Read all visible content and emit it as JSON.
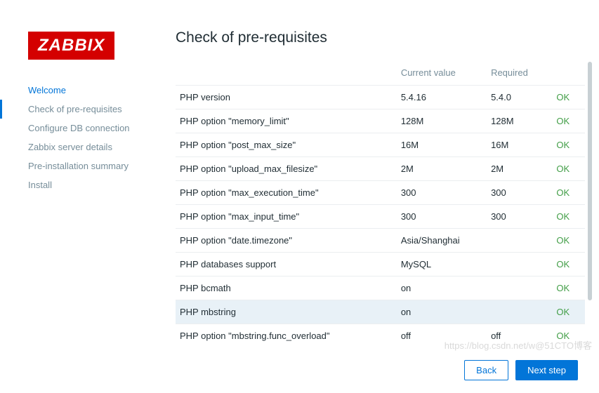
{
  "logo": "ZABBIX",
  "nav": [
    {
      "label": "Welcome",
      "state": "completed"
    },
    {
      "label": "Check of pre-requisites",
      "state": "active"
    },
    {
      "label": "Configure DB connection",
      "state": ""
    },
    {
      "label": "Zabbix server details",
      "state": ""
    },
    {
      "label": "Pre-installation summary",
      "state": ""
    },
    {
      "label": "Install",
      "state": ""
    }
  ],
  "page_title": "Check of pre-requisites",
  "columns": {
    "name": "",
    "current": "Current value",
    "required": "Required",
    "status": ""
  },
  "rows": [
    {
      "name": "PHP version",
      "current": "5.4.16",
      "required": "5.4.0",
      "status": "OK"
    },
    {
      "name": "PHP option \"memory_limit\"",
      "current": "128M",
      "required": "128M",
      "status": "OK"
    },
    {
      "name": "PHP option \"post_max_size\"",
      "current": "16M",
      "required": "16M",
      "status": "OK"
    },
    {
      "name": "PHP option \"upload_max_filesize\"",
      "current": "2M",
      "required": "2M",
      "status": "OK"
    },
    {
      "name": "PHP option \"max_execution_time\"",
      "current": "300",
      "required": "300",
      "status": "OK"
    },
    {
      "name": "PHP option \"max_input_time\"",
      "current": "300",
      "required": "300",
      "status": "OK"
    },
    {
      "name": "PHP option \"date.timezone\"",
      "current": "Asia/Shanghai",
      "required": "",
      "status": "OK"
    },
    {
      "name": "PHP databases support",
      "current": "MySQL",
      "required": "",
      "status": "OK"
    },
    {
      "name": "PHP bcmath",
      "current": "on",
      "required": "",
      "status": "OK"
    },
    {
      "name": "PHP mbstring",
      "current": "on",
      "required": "",
      "status": "OK",
      "hover": true
    },
    {
      "name": "PHP option \"mbstring.func_overload\"",
      "current": "off",
      "required": "off",
      "status": "OK"
    }
  ],
  "buttons": {
    "back": "Back",
    "next": "Next step"
  },
  "watermark": "https://blog.csdn.net/w@51CTO博客"
}
